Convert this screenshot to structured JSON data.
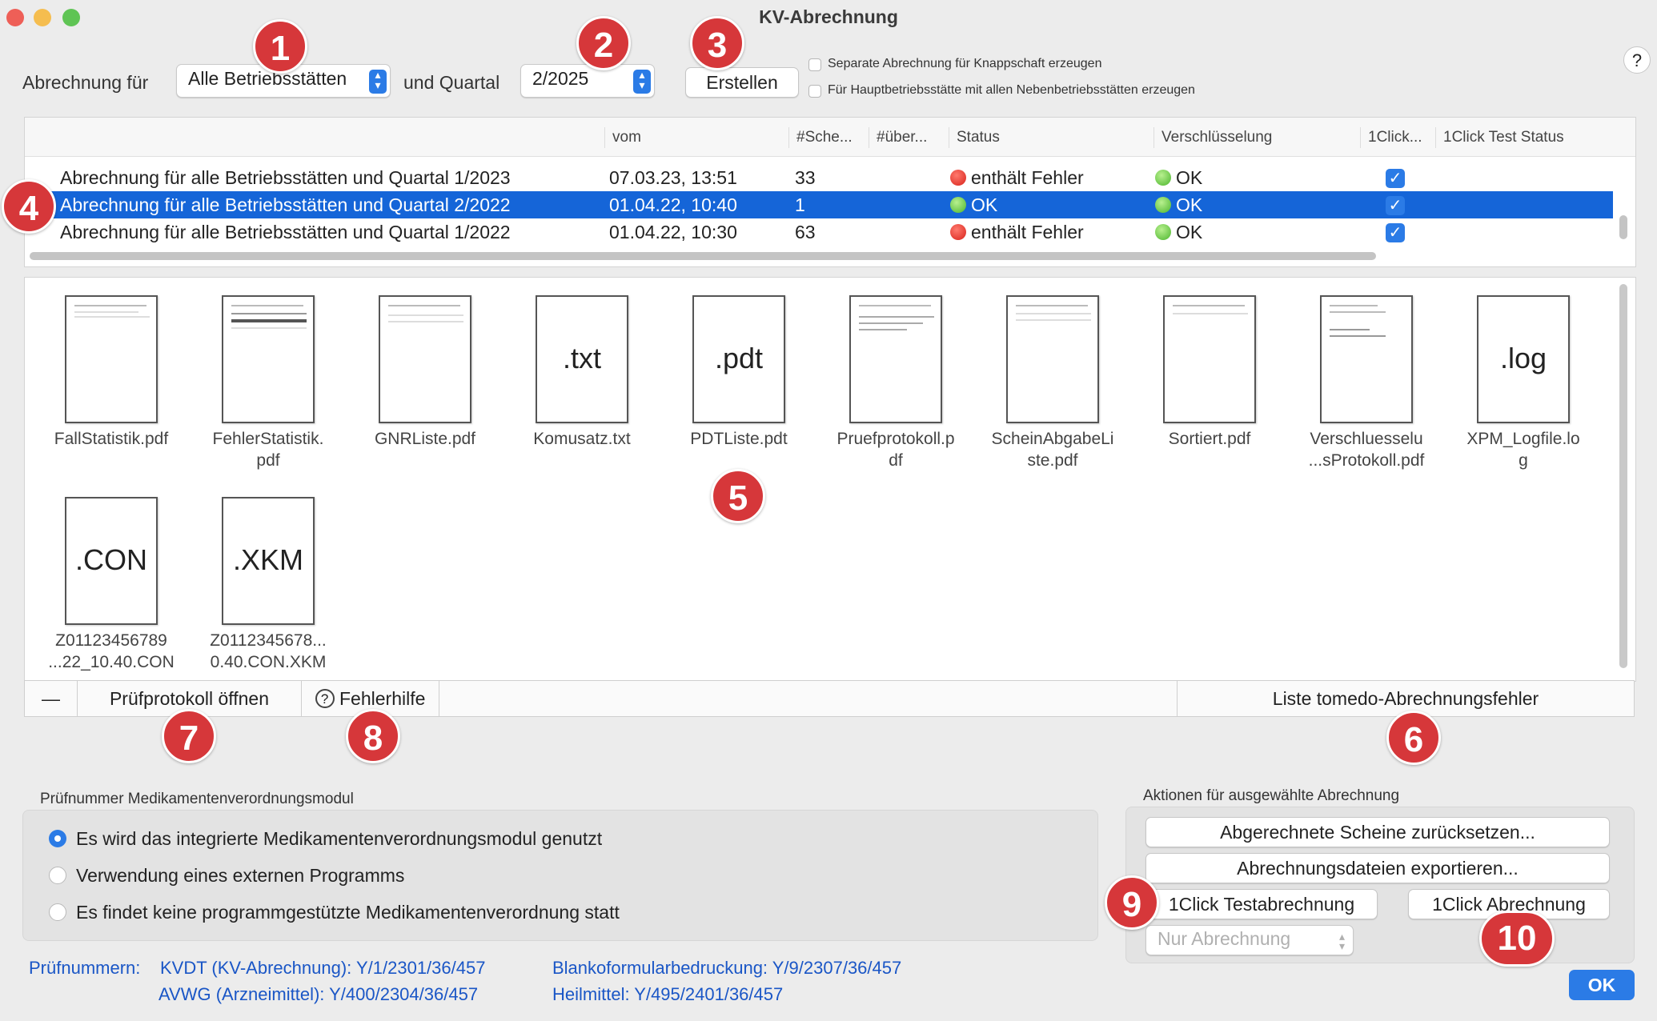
{
  "window": {
    "title": "KV-Abrechnung",
    "help": "?"
  },
  "top": {
    "label_for": "Abrechnung für",
    "site_value": "Alle Betriebsstätten",
    "label_quarter": "und Quartal",
    "quarter_value": "2/2025",
    "create_button": "Erstellen",
    "check1": "Separate Abrechnung für Knappschaft erzeugen",
    "check2": "Für Hauptbetriebsstätte mit allen Nebenbetriebsstätten erzeugen"
  },
  "table": {
    "columns": [
      "vom",
      "#Sche...",
      "#über...",
      "Status",
      "Verschlüsselung",
      "1Click...",
      "1Click Test Status"
    ],
    "rows": [
      {
        "name": "Abrechnung für alle Betriebsstätten und Quartal 1/2023",
        "date": "07.03.23, 13:51",
        "count": "33",
        "status": "enthält Fehler",
        "enc": "OK",
        "selected": false,
        "status_color": "red"
      },
      {
        "name": "Abrechnung für alle Betriebsstätten und Quartal 2/2022",
        "date": "01.04.22, 10:40",
        "count": "1",
        "status": "OK",
        "enc": "OK",
        "selected": true,
        "status_color": "green"
      },
      {
        "name": "Abrechnung für alle Betriebsstätten und Quartal 1/2022",
        "date": "01.04.22, 10:30",
        "count": "63",
        "status": "enthält Fehler",
        "enc": "OK",
        "selected": false,
        "status_color": "red"
      }
    ]
  },
  "files": [
    {
      "line1": "FallStatistik.pdf",
      "line2": "",
      "ext": ""
    },
    {
      "line1": "FehlerStatistik.",
      "line2": "pdf",
      "ext": ""
    },
    {
      "line1": "GNRListe.pdf",
      "line2": "",
      "ext": ""
    },
    {
      "line1": "Komusatz.txt",
      "line2": "",
      "ext": ".txt"
    },
    {
      "line1": "PDTListe.pdt",
      "line2": "",
      "ext": ".pdt"
    },
    {
      "line1": "Pruefprotokoll.p",
      "line2": "df",
      "ext": ""
    },
    {
      "line1": "ScheinAbgabeLi",
      "line2": "ste.pdf",
      "ext": ""
    },
    {
      "line1": "Sortiert.pdf",
      "line2": "",
      "ext": ""
    },
    {
      "line1": "Verschluesselu",
      "line2": "...sProtokoll.pdf",
      "ext": ""
    },
    {
      "line1": "XPM_Logfile.lo",
      "line2": "g",
      "ext": ".log"
    },
    {
      "line1": "Z01123456789",
      "line2": "...22_10.40.CON",
      "ext": ".CON"
    },
    {
      "line1": "Z0112345678...",
      "line2": "0.40.CON.XKM",
      "ext": ".XKM"
    }
  ],
  "bottombar": {
    "minus": "—",
    "open_protocol": "Prüfprotokoll öffnen",
    "help_icon": "?",
    "error_help": "Fehlerhilfe",
    "error_list": "Liste tomedo-Abrechnungsfehler"
  },
  "medication": {
    "title": "Prüfnummer Medikamentenverordnungsmodul",
    "options": [
      "Es wird das integrierte Medikamentenverordnungsmodul genutzt",
      "Verwendung eines externen Programms",
      "Es findet keine programmgestützte Medikamentenverordnung statt"
    ]
  },
  "actions": {
    "title": "Aktionen für ausgewählte Abrechnung",
    "reset": "Abgerechnete Scheine zurücksetzen...",
    "export": "Abrechnungsdateien exportieren...",
    "test": "1Click Testabrechnung",
    "oneclick": "1Click Abrechnung",
    "mode": "Nur Abrechnung"
  },
  "pruef": {
    "label": "Prüfnummern:",
    "kvdt": "KVDT (KV-Abrechnung): Y/1/2301/36/457",
    "avwg": "AVWG (Arzneimittel): Y/400/2304/36/457",
    "blanko": "Blankoformularbedruckung: Y/9/2307/36/457",
    "heil": "Heilmittel: Y/495/2401/36/457"
  },
  "ok_button": "OK",
  "badges": [
    "1",
    "2",
    "3",
    "4",
    "5",
    "6",
    "7",
    "8",
    "9",
    "10"
  ]
}
